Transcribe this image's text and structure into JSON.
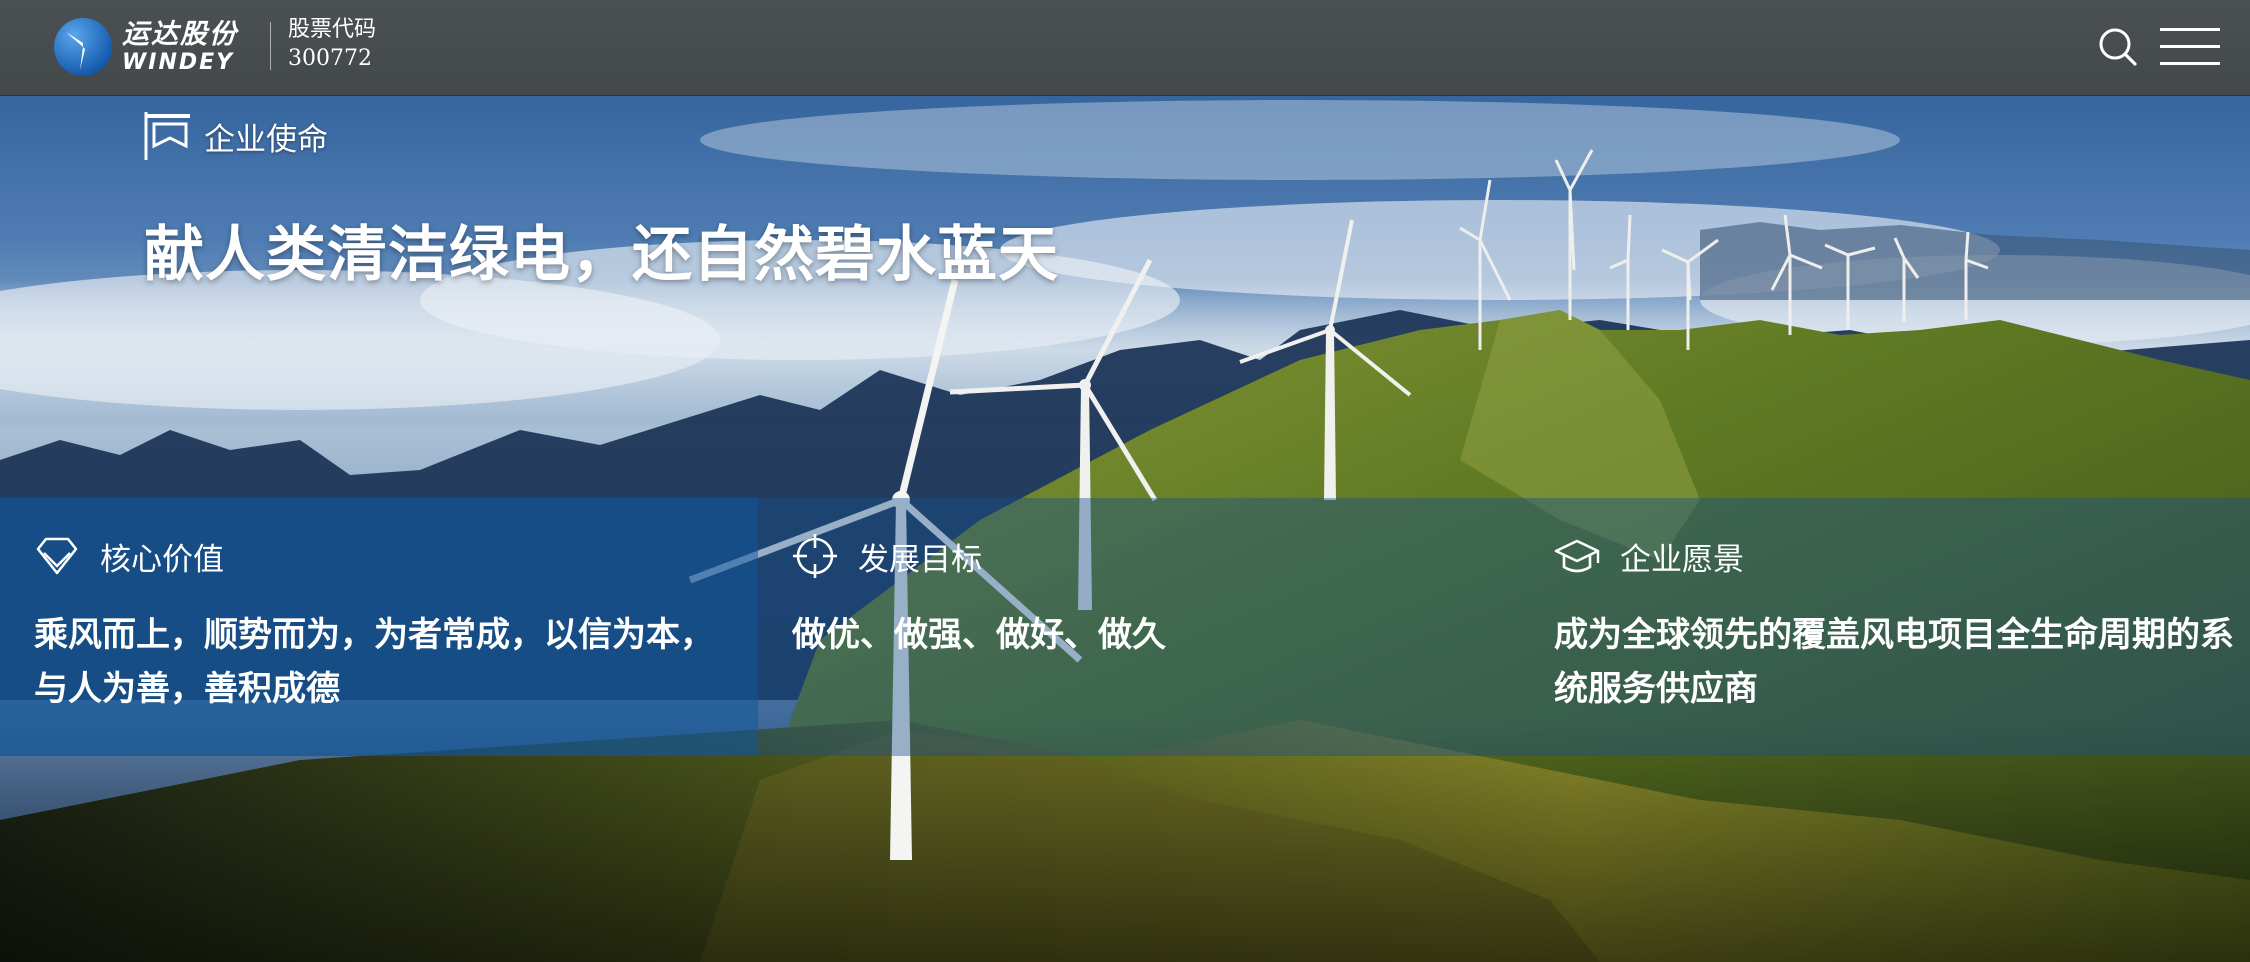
{
  "header": {
    "logo_cn": "运达股份",
    "logo_en": "WINDEY",
    "stock_label": "股票代码",
    "stock_code": "300772",
    "icons": {
      "search": "search-icon",
      "menu": "hamburger-menu-icon"
    }
  },
  "mission": {
    "label": "企业使命",
    "text": "献人类清洁绿电，还自然碧水蓝天",
    "icon": "flag-icon"
  },
  "panels": [
    {
      "title": "核心价值",
      "icon": "diamond-icon",
      "body": "乘风而上，顺势而为，为者常成，以信为本，与人为善，善积成德"
    },
    {
      "title": "发展目标",
      "icon": "crosshair-icon",
      "body": "做优、做强、做好、做久"
    },
    {
      "title": "企业愿景",
      "icon": "graduation-cap-icon",
      "body": "成为全球领先的覆盖风电项目全生命周期的系统服务供应商"
    }
  ],
  "colors": {
    "header_bg": "#474c4e",
    "panel_blue": "#125496",
    "sky_top": "#2f5e9a",
    "hill_green": "#6f8a2a"
  }
}
